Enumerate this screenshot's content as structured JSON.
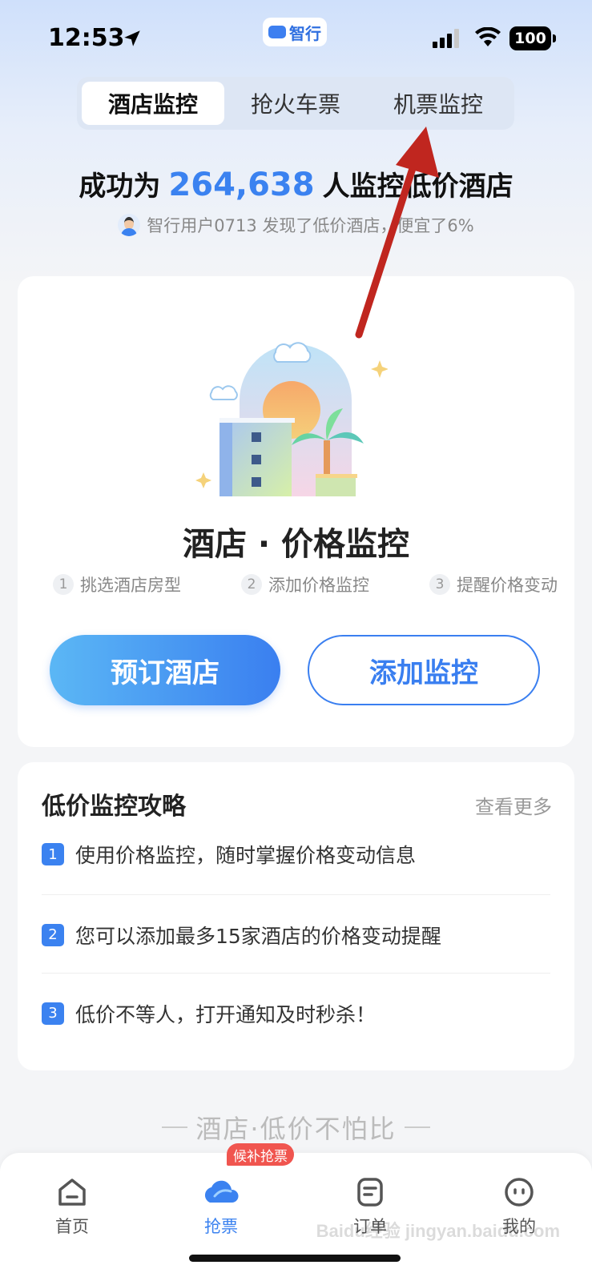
{
  "status_bar": {
    "time": "12:53",
    "app_name": "智行",
    "battery": "100"
  },
  "tabs": [
    {
      "label": "酒店监控",
      "active": true
    },
    {
      "label": "抢火车票",
      "active": false
    },
    {
      "label": "机票监控",
      "active": false
    }
  ],
  "headline": {
    "prefix": "成功为",
    "count": "264,638",
    "suffix": "人监控低价酒店"
  },
  "subline": "智行用户0713 发现了低价酒店，便宜了6%",
  "main_card": {
    "title": "酒店 · 价格监控",
    "steps": [
      {
        "num": "1",
        "label": "挑选酒店房型"
      },
      {
        "num": "2",
        "label": "添加价格监控"
      },
      {
        "num": "3",
        "label": "提醒价格变动"
      }
    ],
    "book_button": "预订酒店",
    "add_button": "添加监控"
  },
  "tips": {
    "title": "低价监控攻略",
    "more": "查看更多",
    "items": [
      {
        "num": "1",
        "text": "使用价格监控，随时掌握价格变动信息"
      },
      {
        "num": "2",
        "text": "您可以添加最多15家酒店的价格变动提醒"
      },
      {
        "num": "3",
        "text": "低价不等人，打开通知及时秒杀！"
      }
    ]
  },
  "slogan": "酒店·低价不怕比",
  "bottom_nav": {
    "badge": "候补抢票",
    "items": [
      {
        "label": "首页",
        "icon": "home-icon"
      },
      {
        "label": "抢票",
        "icon": "ticket-cloud-icon",
        "active": true
      },
      {
        "label": "订单",
        "icon": "order-icon"
      },
      {
        "label": "我的",
        "icon": "profile-icon"
      }
    ]
  },
  "watermark": "Baidu经验 jingyan.baidu.com",
  "colors": {
    "accent": "#3b82f0",
    "badge": "#f0554f",
    "annotation_arrow": "#c0261f"
  }
}
